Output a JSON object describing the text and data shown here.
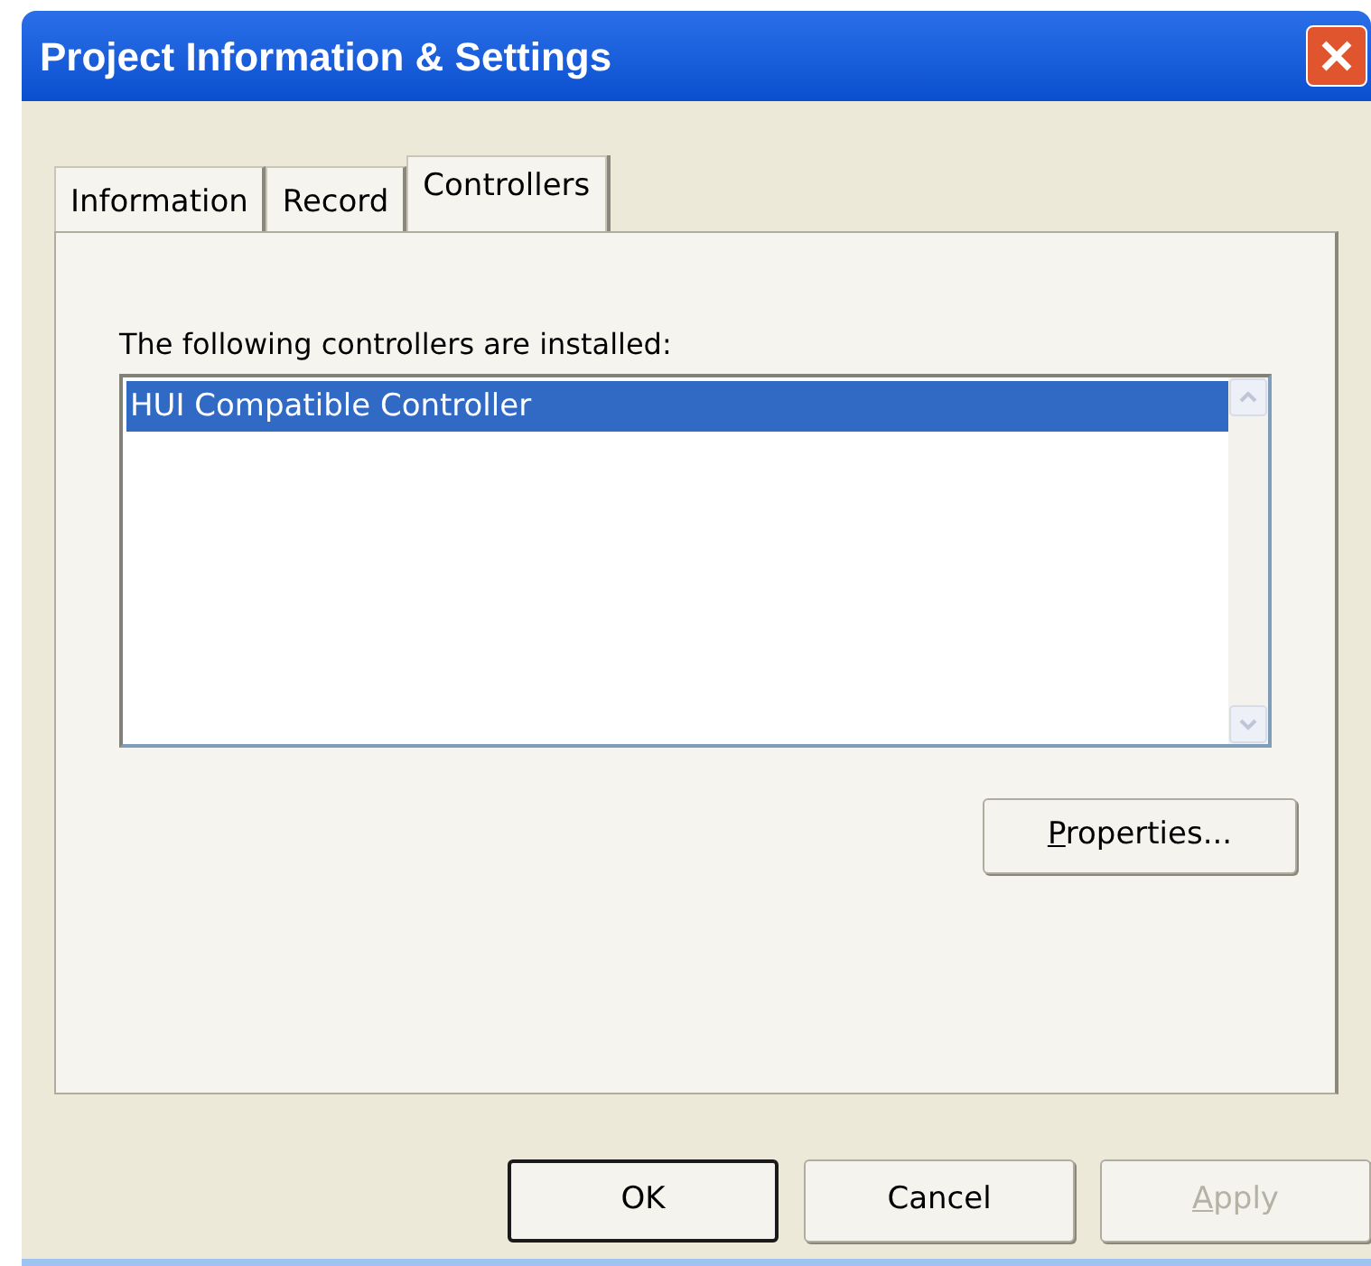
{
  "window": {
    "title": "Project Information & Settings"
  },
  "tabs": [
    {
      "label": "Information",
      "selected": false
    },
    {
      "label": "Record",
      "selected": false
    },
    {
      "label": "Controllers",
      "selected": true
    }
  ],
  "controllers": {
    "label": "The following controllers are installed:",
    "items": [
      {
        "label": "HUI Compatible Controller",
        "selected": true
      }
    ],
    "properties_button": {
      "label": "Properties...",
      "underline_first": true,
      "disabled": false
    }
  },
  "buttons": [
    {
      "label": "OK",
      "default": true,
      "disabled": false,
      "underline_first": false
    },
    {
      "label": "Cancel",
      "default": false,
      "disabled": false,
      "underline_first": false
    },
    {
      "label": "Apply",
      "default": false,
      "disabled": true,
      "underline_first": true
    }
  ]
}
